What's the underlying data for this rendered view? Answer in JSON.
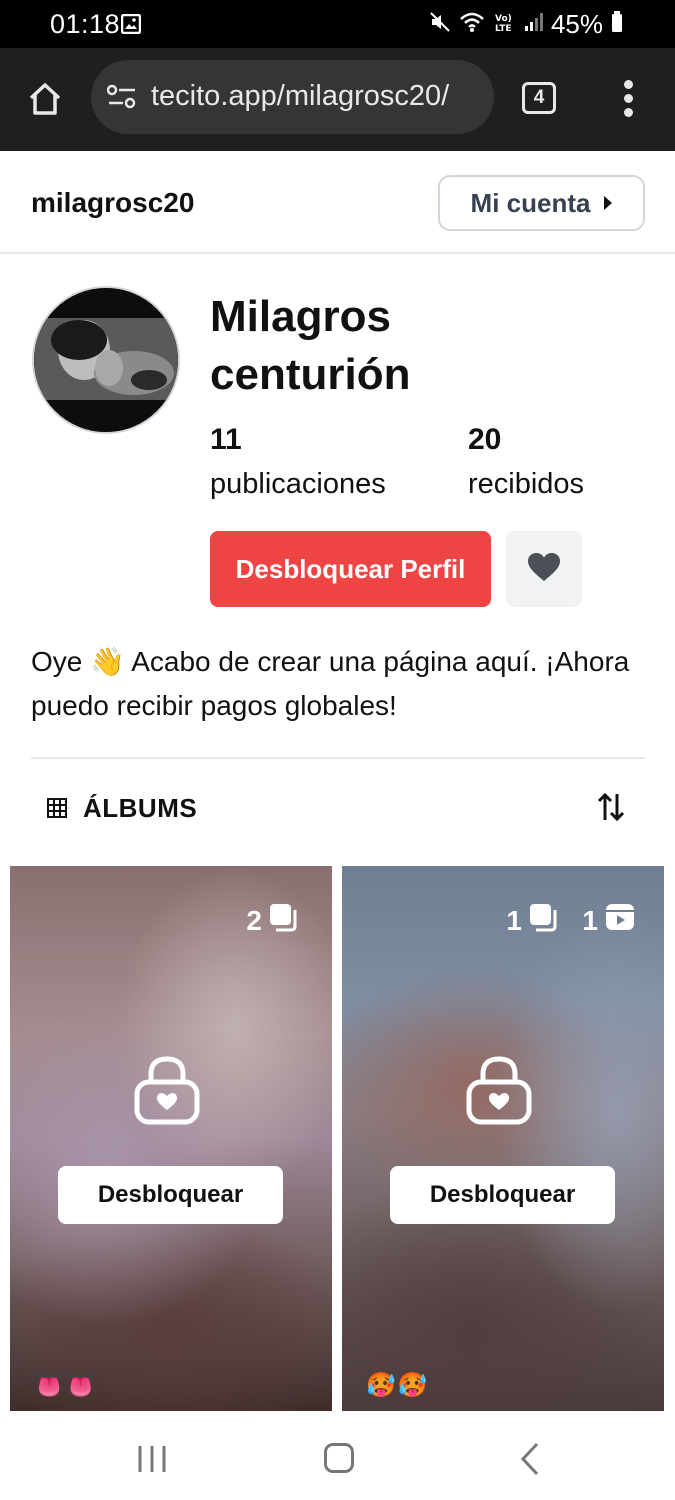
{
  "status_bar": {
    "time": "01:18",
    "battery": "45%"
  },
  "browser": {
    "url": "tecito.app/milagrosc20/",
    "tab_count": "4"
  },
  "header": {
    "username": "milagrosc20",
    "account_button": "Mi cuenta"
  },
  "profile": {
    "name": "Milagros centurión",
    "stats": [
      {
        "value": "11",
        "label": "publicaciones"
      },
      {
        "value": "20",
        "label": "recibidos"
      }
    ],
    "unlock_button": "Desbloquear Perfil",
    "bio": "Oye 👋 Acabo de crear una página aquí. ¡Ahora puedo recibir pagos globales!"
  },
  "albums": {
    "label": "ÁLBUMS",
    "cards": [
      {
        "photo_count": "2",
        "video_count": "",
        "unlock_label": "Desbloquear",
        "emojis": "👅👅"
      },
      {
        "photo_count": "1",
        "video_count": "1",
        "unlock_label": "Desbloquear",
        "emojis": "🥵🥵"
      }
    ]
  },
  "colors": {
    "accent": "#ef4444",
    "browser_bg": "#1f1f1f"
  }
}
